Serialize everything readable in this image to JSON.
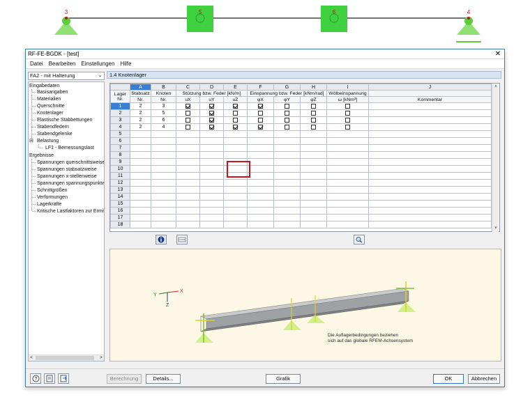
{
  "model": {
    "nodes": [
      {
        "label": "3",
        "kind": "support"
      },
      {
        "label": "5",
        "kind": "spring"
      },
      {
        "label": "6",
        "kind": "spring"
      },
      {
        "label": "4",
        "kind": "support"
      }
    ]
  },
  "window": {
    "title": "RF-FE-BGDK - [test]",
    "close": "✕",
    "menu": [
      "Datei",
      "Bearbeiten",
      "Einstellungen",
      "Hilfe"
    ]
  },
  "case_select": {
    "value": "FA2 - mit Halterung",
    "arrow": "⌄"
  },
  "navigator": {
    "sections": [
      {
        "label": "Eingabedaten",
        "items": [
          "Basisangaben",
          "Materialien",
          "Querschnitte",
          "Knotenlager",
          "Elastische Stabbettungen",
          "Stabendfedern",
          "Stabendgelenke"
        ]
      },
      {
        "label": "Belastung",
        "items": [
          "LF1 - Bemessungslast"
        ]
      },
      {
        "label": "Ergebnisse",
        "items": [
          "Spannungen querschnittsweise",
          "Spannungen stabsatzweise",
          "Spannungen x-stellenweise",
          "Spannungen spannungspunktw",
          "Schnittgrößen",
          "Verformungen",
          "Lagerkräfte",
          "Kritische Lastfaktoren zur Ermit"
        ]
      }
    ]
  },
  "panel": {
    "title": "1.4 Knotenlager",
    "col_letters": [
      "A",
      "B",
      "C",
      "D",
      "E",
      "F",
      "G",
      "H",
      "I",
      "J"
    ],
    "header_row1": {
      "lager": "Lager",
      "stabsatz": "Stabsatz",
      "knoten": "Knoten",
      "stuetzung": "Stützung bzw. Feder [kN/m]",
      "einspannung": "Einspannung bzw. Feder [kNm/rad]",
      "woelb": "Wölbeinspannung",
      "kommentar": ""
    },
    "header_row2": {
      "lager": "Nr.",
      "stabsatz": "Nr.",
      "knoten": "Nr.",
      "ux": "uX",
      "uy": "uY",
      "uz": "uZ",
      "phix": "φX",
      "phiy": "φY",
      "phiz": "φZ",
      "omega": "ω [kNm³]",
      "kommentar": "Kommentar"
    },
    "rows": [
      {
        "nr": "1",
        "stabsatz": "2",
        "knoten": "3",
        "ux": true,
        "uy": true,
        "uz": true,
        "phix": true,
        "phiy": false,
        "phiz": false,
        "omega": false
      },
      {
        "nr": "2",
        "stabsatz": "2",
        "knoten": "5",
        "ux": false,
        "uy": true,
        "uz": false,
        "phix": false,
        "phiy": false,
        "phiz": false,
        "omega": false
      },
      {
        "nr": "3",
        "stabsatz": "2",
        "knoten": "6",
        "ux": false,
        "uy": true,
        "uz": false,
        "phix": false,
        "phiy": false,
        "phiz": false,
        "omega": false
      },
      {
        "nr": "4",
        "stabsatz": "2",
        "knoten": "4",
        "ux": false,
        "uy": true,
        "uz": true,
        "phix": true,
        "phiy": false,
        "phiz": false,
        "omega": false
      }
    ],
    "empty_rows": [
      "5",
      "6",
      "7",
      "8",
      "9",
      "10",
      "11",
      "12",
      "13",
      "14",
      "15",
      "16",
      "17",
      "18"
    ]
  },
  "graphic": {
    "note_line1": "Die Auflagerbedingungen beziehen",
    "note_line2": "sich auf das globale RFEM-Achsensystem",
    "axis_x": "X",
    "axis_y": "Y",
    "axis_z": "Z"
  },
  "buttons": {
    "berechnung": "Berechnung",
    "details": "Details...",
    "grafik": "Grafik",
    "ok": "OK",
    "abbrechen": "Abbrechen"
  },
  "colors": {
    "accent": "#3a7fd6",
    "highlight": "#c6161c",
    "support": "#6fcf3a",
    "spring": "#3fd13f",
    "node_label": "#c0141b"
  }
}
